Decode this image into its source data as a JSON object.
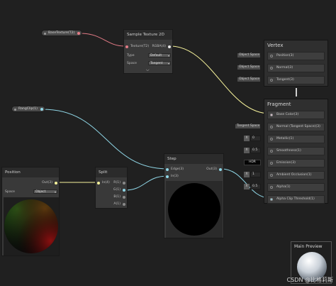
{
  "properties": {
    "base_texture": "BaseTexture(T2)",
    "range_clip": "RangClip(1)"
  },
  "sample_texture": {
    "title": "Sample Texture 2D",
    "input_texture": "Texture(T2)",
    "output_rgba": "RGBA(4)",
    "type_label": "Type",
    "type_value": "Default",
    "space_label": "Space",
    "space_value": "Tangent"
  },
  "position": {
    "title": "Position",
    "output": "Out(3)",
    "space_label": "Space",
    "space_value": "Object"
  },
  "split": {
    "title": "Split",
    "input": "In(4)",
    "outputs": [
      "R(1)",
      "G(1)",
      "B(1)",
      "A(1)"
    ]
  },
  "step": {
    "title": "Step",
    "input_edge": "Edge(3)",
    "input_in": "In(3)",
    "output": "Out(3)"
  },
  "vertex": {
    "title": "Vertex",
    "rows": [
      "Position(3)",
      "Normal(3)",
      "Tangent(3)"
    ],
    "side_labels": [
      "Object Space",
      "Object Space",
      "Object Space"
    ]
  },
  "fragment": {
    "title": "Fragment",
    "rows": [
      "Base Color(3)",
      "Normal (Tangent Space)(3)",
      "Metallic(1)",
      "Smoothness(1)",
      "Emission(3)",
      "Ambient Occlusion(1)",
      "Alpha(1)",
      "Alpha Clip Threshold(1)"
    ],
    "normal_side": "Tangent Space",
    "metallic_value": "0",
    "smoothness_value": "0.5",
    "emission_side": "HDR",
    "ao_value": "1",
    "alpha_value": "0.5",
    "x_label": "X"
  },
  "main_preview": {
    "title": "Main Preview"
  },
  "watermark": "CSDN @比格莉斯",
  "colors": {
    "texture_wire": "#e37b86",
    "vector_wire": "#f6f29b",
    "float_wire": "#8fd6e6",
    "edge_port": "#8fd6e6",
    "base_port": "#e8c8d6"
  }
}
